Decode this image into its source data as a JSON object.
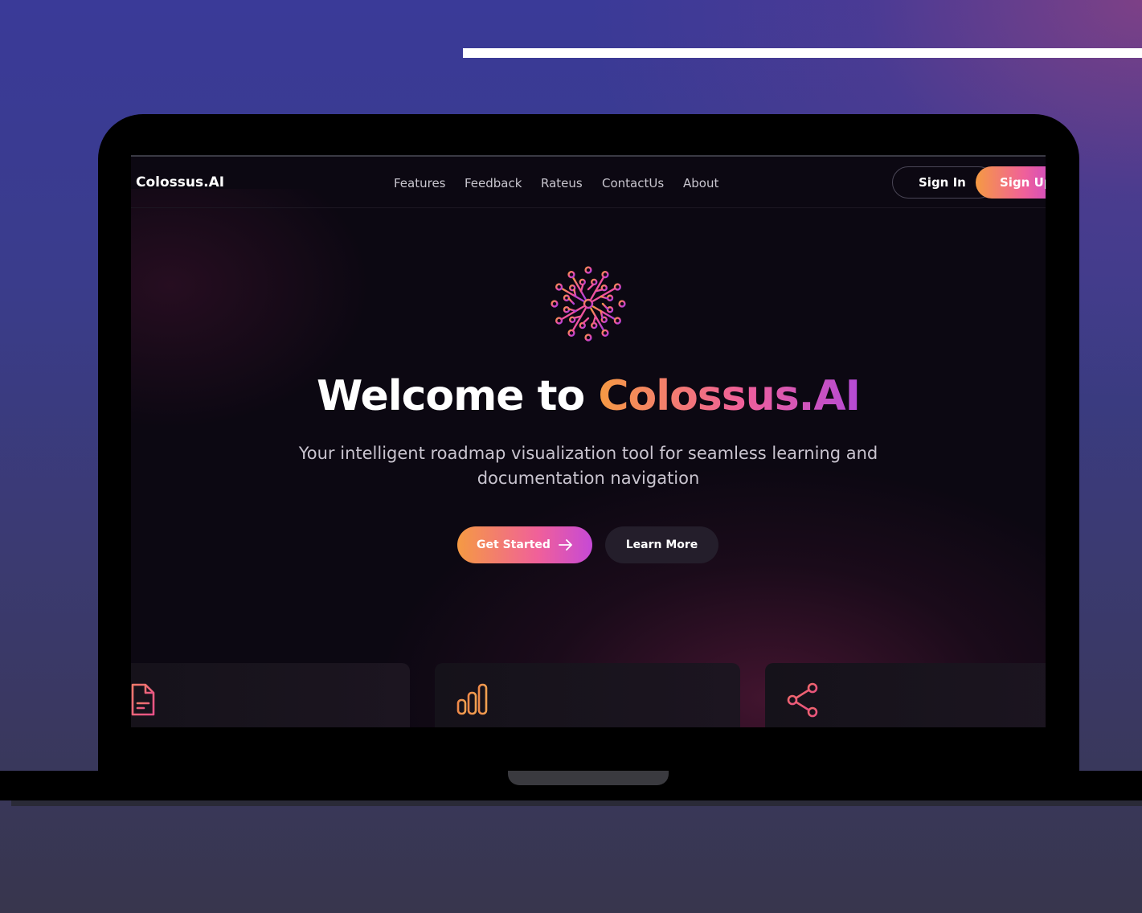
{
  "app": {
    "brand": "Colossus.AI"
  },
  "nav": {
    "links": [
      "Features",
      "Feedback",
      "Rateus",
      "ContactUs",
      "About"
    ],
    "sign_in": "Sign In",
    "sign_up": "Sign Up"
  },
  "hero": {
    "title_plain": "Welcome to ",
    "title_highlight": "Colossus.AI",
    "subtitle": "Your intelligent roadmap visualization tool for seamless learning and documentation navigation",
    "primary_button": "Get Started",
    "secondary_button": "Learn More"
  },
  "feature_cards": [
    {
      "icon": "document-icon"
    },
    {
      "icon": "bar-chart-icon"
    },
    {
      "icon": "share-icon"
    }
  ],
  "colors": {
    "accent_orange": "#f59a43",
    "accent_pink": "#f0609a",
    "accent_purple": "#c044d2",
    "page_background": "#3a3a98",
    "screen_background": "#0c0812"
  }
}
